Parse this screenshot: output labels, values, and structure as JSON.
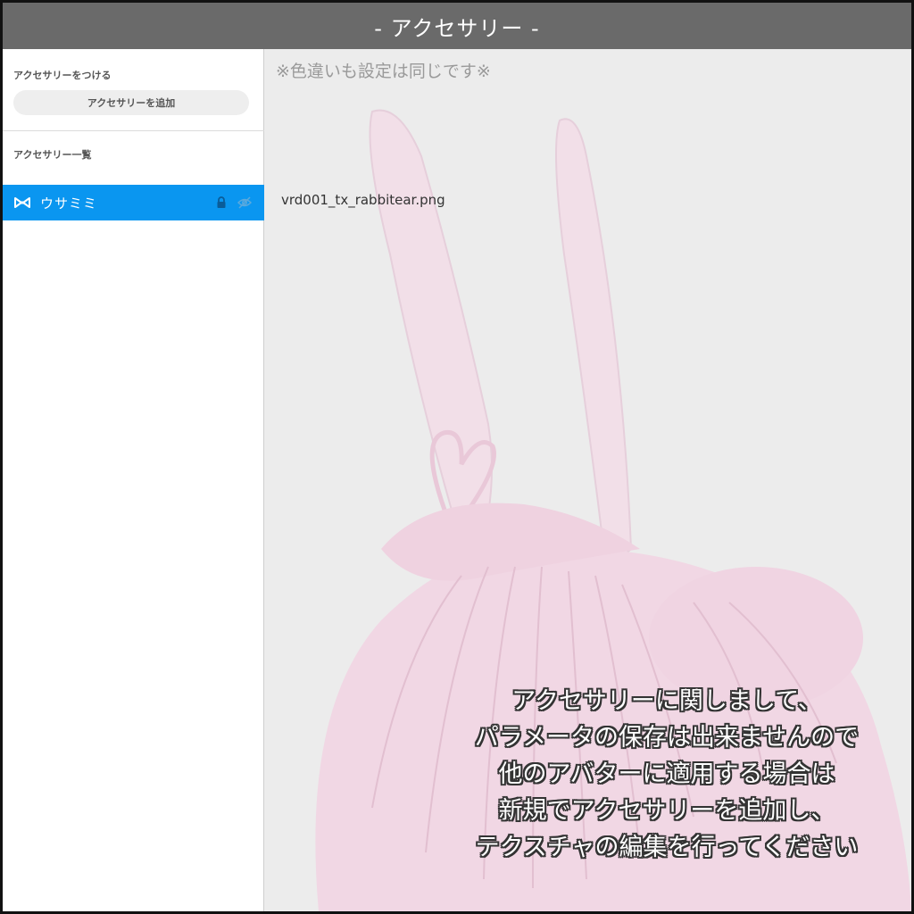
{
  "window": {
    "title": "- アクセサリー -"
  },
  "sidebar": {
    "attach_label": "アクセサリーをつける",
    "add_button_label": "アクセサリーを追加",
    "list_label": "アクセサリー一覧",
    "items": [
      {
        "label": "ウサミミ",
        "icon": "bow-icon",
        "selected": true,
        "locked": true,
        "hidden": true
      }
    ]
  },
  "main": {
    "note": "※色違いも設定は同じです※",
    "filename": "vrd001_tx_rabbitear.png",
    "info_lines": [
      "アクセサリーに関しまして、",
      "パラメータの保存は出来ませんので",
      "他のアバターに適用する場合は",
      "新規でアクセサリーを追加し、",
      "テクスチャの編集を行ってください"
    ]
  },
  "colors": {
    "titlebar": "#6a6a6a",
    "selected_item": "#0a96f0",
    "texture_pink": "#f1d7e4",
    "canvas_bg": "#ececec"
  }
}
